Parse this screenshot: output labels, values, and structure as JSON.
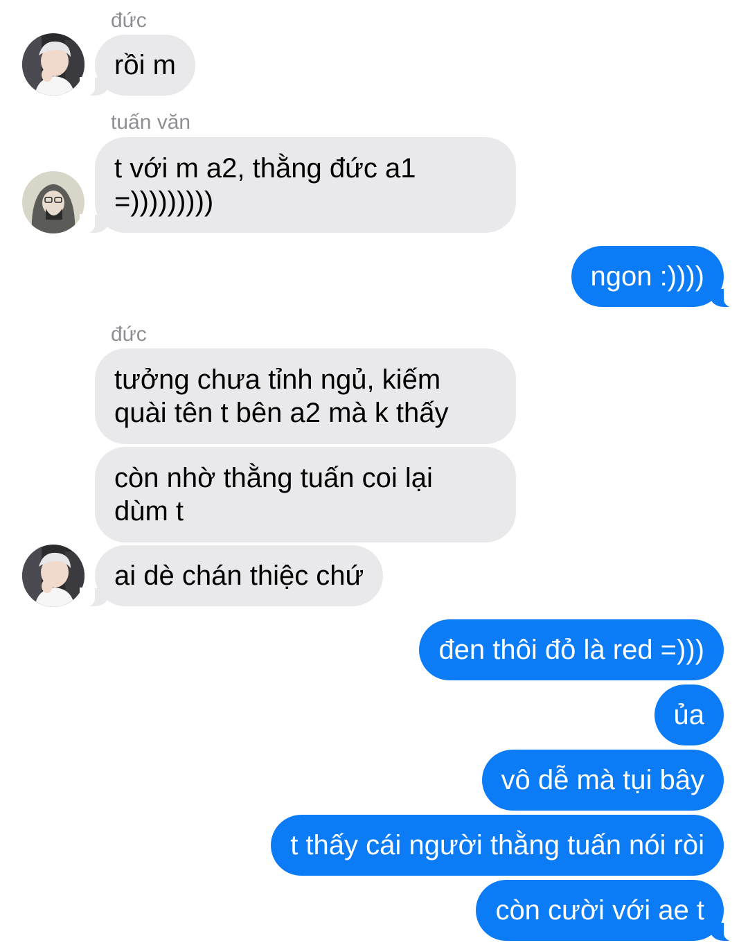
{
  "colors": {
    "incoming_bubble": "#e9e9eb",
    "outgoing_bubble": "#0b7cf6",
    "sender_label": "#8e8e93",
    "background": "#ffffff"
  },
  "conversation": {
    "messages": [
      {
        "direction": "incoming",
        "sender": "đức",
        "text": "rồi m",
        "avatar": "duc-avatar"
      },
      {
        "direction": "incoming",
        "sender": "tuấn văn",
        "text": "t với m a2, thằng đức a1\n=)))))))))",
        "avatar": "tuan-avatar"
      },
      {
        "direction": "outgoing",
        "text": "ngon :))))"
      },
      {
        "direction": "incoming",
        "sender": "đức",
        "text": "tưởng chưa tỉnh ngủ, kiếm\nquài tên t bên a2 mà k thấy"
      },
      {
        "direction": "incoming",
        "text": "còn nhờ thằng tuấn coi lại\ndùm t"
      },
      {
        "direction": "incoming",
        "text": "ai dè chán thiệc chứ",
        "avatar": "duc-avatar"
      },
      {
        "direction": "outgoing",
        "text": "đen thôi đỏ là red =)))"
      },
      {
        "direction": "outgoing",
        "text": "ủa"
      },
      {
        "direction": "outgoing",
        "text": "vô dễ mà tụi bây"
      },
      {
        "direction": "outgoing",
        "text": "t thấy cái người thằng tuấn nói ròi"
      },
      {
        "direction": "outgoing",
        "text": "còn cười với ae t"
      }
    ]
  }
}
